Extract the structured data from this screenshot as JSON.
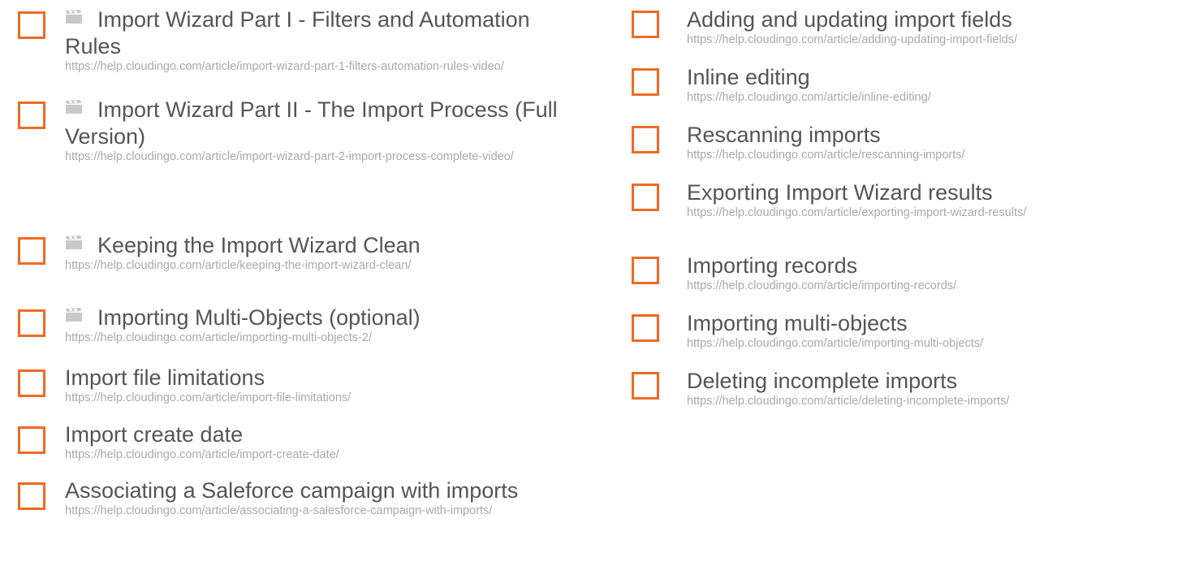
{
  "left_items": [
    {
      "title": "Import Wizard Part I - Filters and Automation Rules",
      "video": true,
      "url": "https://help.cloudingo.com/article/import-wizard-part-1-filters-automation-rules-video/"
    },
    {
      "title": "Import Wizard Part II - The Import Process (Full Version)",
      "video": true,
      "url": "https://help.cloudingo.com/article/import-wizard-part-2-import-process-complete-video/"
    },
    {
      "title": "Keeping the Import Wizard Clean",
      "video": true,
      "url": "https://help.cloudingo.com/article/keeping-the-import-wizard-clean/"
    },
    {
      "title": "Importing Multi-Objects (optional)",
      "video": true,
      "url": "https://help.cloudingo.com/article/importing-multi-objects-2/"
    },
    {
      "title": "Import file limitations",
      "video": false,
      "url": "https://help.cloudingo.com/article/import-file-limitations/"
    },
    {
      "title": "Import create date",
      "video": false,
      "url": "https://help.cloudingo.com/article/import-create-date/"
    },
    {
      "title": "Associating a Saleforce campaign with imports",
      "video": false,
      "url": "https://help.cloudingo.com/article/associating-a-salesforce-campaign-with-imports/"
    }
  ],
  "right_items": [
    {
      "title": "Adding and updating import fields",
      "video": false,
      "url": "https://help.cloudingo.com/article/adding-updating-import-fields/"
    },
    {
      "title": "Inline editing",
      "video": false,
      "url": "https://help.cloudingo.com/article/inline-editing/"
    },
    {
      "title": "Rescanning imports",
      "video": false,
      "url": "https://help.cloudingo.com/article/rescanning-imports/"
    },
    {
      "title": "Exporting Import Wizard results",
      "video": false,
      "url": "https://help.cloudingo.com/article/exporting-import-wizard-results/"
    },
    {
      "title": "Importing records",
      "video": false,
      "url": "https://help.cloudingo.com/article/importing-records/"
    },
    {
      "title": "Importing multi-objects",
      "video": false,
      "url": "https://help.cloudingo.com/article/importing-multi-objects/"
    },
    {
      "title": "Deleting incomplete imports",
      "video": false,
      "url": "https://help.cloudingo.com/article/deleting-incomplete-imports/"
    }
  ],
  "colors": {
    "checkbox": "#ef6a25",
    "title": "#555555",
    "url": "#a9a9a9"
  },
  "icons": {
    "video": "clapperboard-icon"
  }
}
